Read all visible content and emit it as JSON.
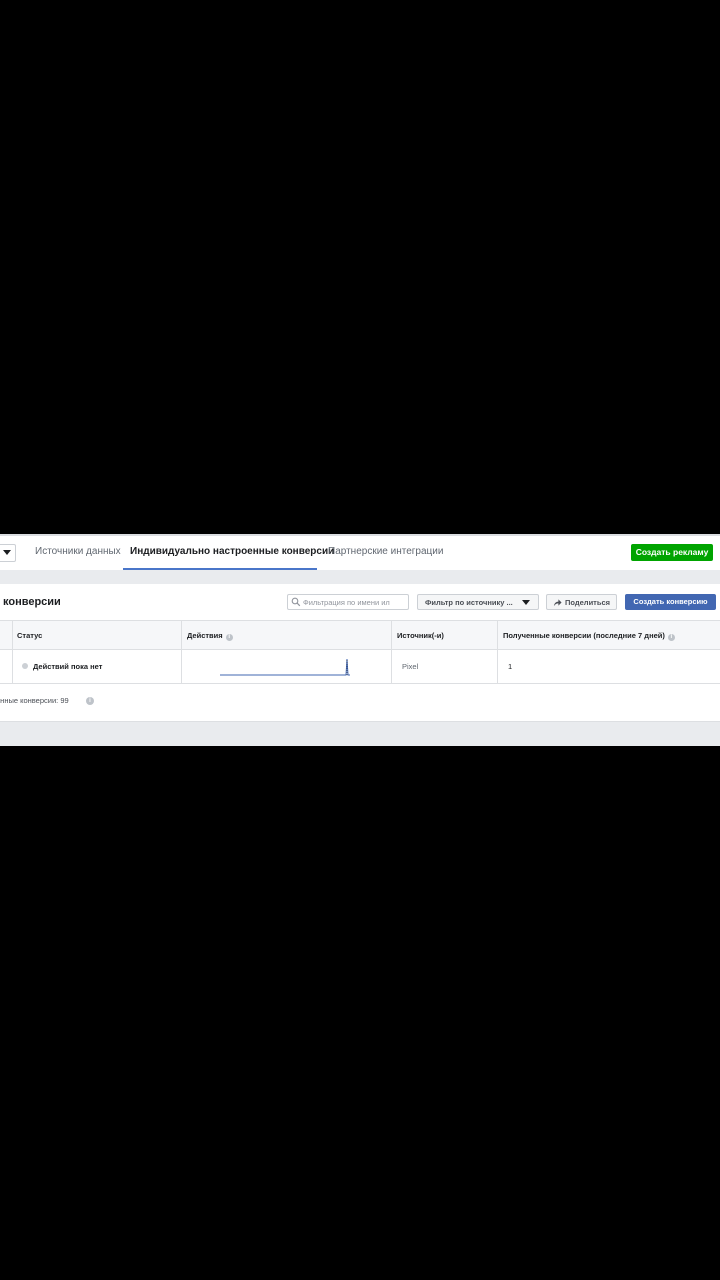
{
  "tabs": [
    {
      "label": "Источники данных"
    },
    {
      "label": "Индивидуально настроенные конверсии"
    },
    {
      "label": "Партнерские интеграции"
    }
  ],
  "topbar": {
    "create_ad_label": "Создать рекламу"
  },
  "panel": {
    "title": "конверсии",
    "search_placeholder": "Фильтрация по имени ил",
    "source_filter_label": "Фильтр по источнику ...",
    "share_label": "Поделиться",
    "create_conversion_label": "Создать конверсию"
  },
  "table": {
    "columns": [
      {
        "label": "Статус"
      },
      {
        "label": "Действия"
      },
      {
        "label": "Источник(-и)"
      },
      {
        "label": "Полученные конверсии (последние 7 дней)"
      }
    ],
    "rows": [
      {
        "status": "Действий пока нет",
        "source": "Pixel",
        "received": "1"
      }
    ]
  },
  "footer": {
    "text": "енные конверсии: 99"
  },
  "colors": {
    "accent": "#4267b2",
    "create_ad": "#00a400",
    "tab_underline": "#4a76c9"
  },
  "icons": {
    "search": "search-icon",
    "share": "share-arrow-icon",
    "info": "info-icon"
  }
}
